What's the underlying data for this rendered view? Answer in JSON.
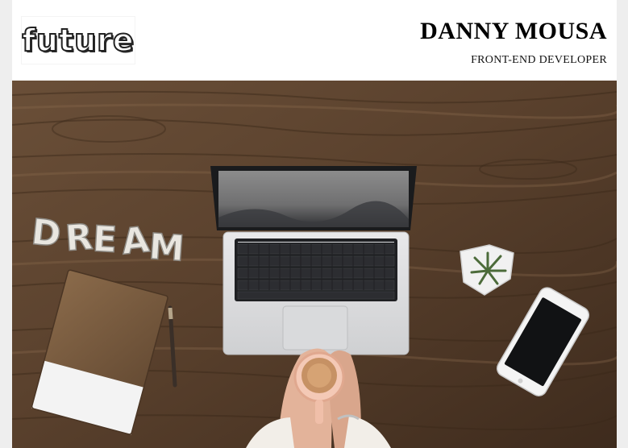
{
  "header": {
    "logo_text": "future",
    "name": "DANNY MOUSA",
    "role": "FRONT-END DEVELOPER"
  },
  "hero": {
    "letters": [
      "D",
      "R",
      "E",
      "A",
      "M"
    ],
    "colors": {
      "wood": "#5b4330",
      "page_bg": "#eeeeee"
    }
  }
}
